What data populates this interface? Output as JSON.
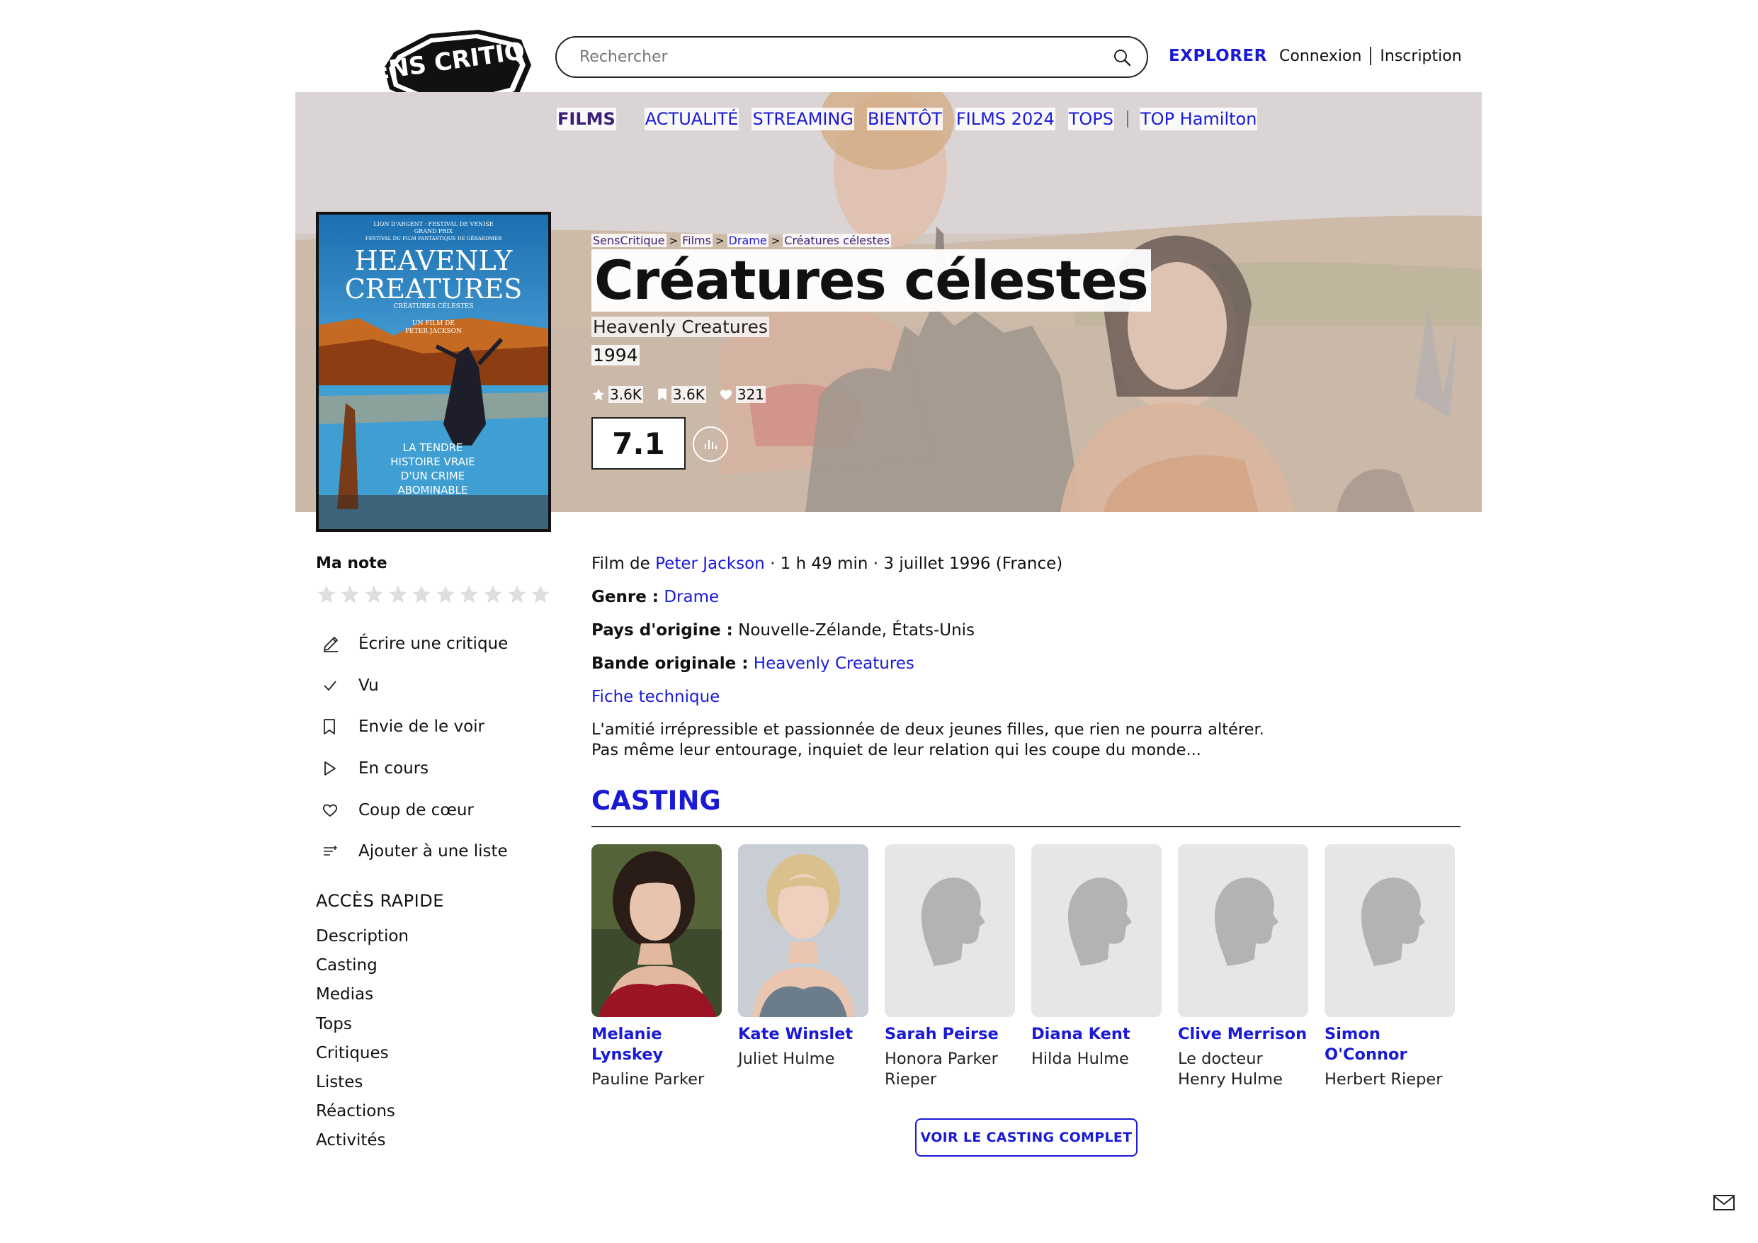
{
  "header": {
    "logo_text": "SENS CRITIQUE",
    "search_placeholder": "Rechercher",
    "explorer": "EXPLORER",
    "login": "Connexion",
    "signup": "Inscription"
  },
  "nav": {
    "active": "FILMS",
    "items": [
      "ACTUALITÉ",
      "STREAMING",
      "BIENTÔT",
      "FILMS 2024",
      "TOPS"
    ],
    "extra": "TOP Hamilton"
  },
  "breadcrumb": [
    "SensCritique",
    "Films",
    "Drame",
    "Créatures célestes"
  ],
  "movie": {
    "title": "Créatures célestes",
    "original_title": "Heavenly Creatures",
    "year": "1994",
    "stats": {
      "ratings": "3.6K",
      "wishlist": "3.6K",
      "favorites": "321"
    },
    "score": "7.1",
    "poster": {
      "top_line1": "LION D'ARGENT · FESTIVAL DE VENISE",
      "top_line2": "GRAND PRIX",
      "top_line3": "FESTIVAL DU FILM FANTASTIQUE DE GÉRARDMER",
      "title1": "HEAVENLY",
      "title2": "CREATURES",
      "subtitle": "CRÉATURES CÉLESTES",
      "by1": "UN FILM DE",
      "by2": "PETER JACKSON",
      "tag1": "LA TENDRE",
      "tag2": "HISTOIRE VRAIE",
      "tag3": "D'UN CRIME",
      "tag4": "ABOMINABLE"
    }
  },
  "sidebar": {
    "my_rating_label": "Ma note",
    "star_count": 10,
    "actions": [
      {
        "label": "Écrire une critique",
        "icon": "pencil-icon"
      },
      {
        "label": "Vu",
        "icon": "check-icon"
      },
      {
        "label": "Envie de le voir",
        "icon": "bookmark-icon"
      },
      {
        "label": "En cours",
        "icon": "play-icon"
      },
      {
        "label": "Coup de cœur",
        "icon": "heart-icon"
      },
      {
        "label": "Ajouter à une liste",
        "icon": "list-add-icon"
      }
    ],
    "quick_access_title": "ACCÈS RAPIDE",
    "quick_access": [
      "Description",
      "Casting",
      "Medias",
      "Tops",
      "Critiques",
      "Listes",
      "Réactions",
      "Activités"
    ]
  },
  "info": {
    "film_de": "Film de",
    "director": "Peter Jackson",
    "details": "· 1 h 49 min · 3 juillet 1996 (France)",
    "genre_label": "Genre :",
    "genre": "Drame",
    "country_label": "Pays d'origine :",
    "country": "Nouvelle-Zélande, États-Unis",
    "soundtrack_label": "Bande originale :",
    "soundtrack": "Heavenly Creatures",
    "tech_sheet": "Fiche technique",
    "synopsis": "L'amitié irrépressible et passionnée de deux jeunes filles, que rien ne pourra altérer. Pas même leur entourage, inquiet de leur relation qui les coupe du monde..."
  },
  "casting": {
    "title": "CASTING",
    "button": "VOIR LE CASTING COMPLET",
    "members": [
      {
        "name": "Melanie Lynskey",
        "role": "Pauline Parker",
        "photo": "photo"
      },
      {
        "name": "Kate Winslet",
        "role": "Juliet Hulme",
        "photo": "photo"
      },
      {
        "name": "Sarah Peirse",
        "role": "Honora Parker Rieper",
        "photo": "placeholder"
      },
      {
        "name": "Diana Kent",
        "role": "Hilda Hulme",
        "photo": "placeholder"
      },
      {
        "name": "Clive Merrison",
        "role": "Le docteur Henry Hulme",
        "photo": "placeholder"
      },
      {
        "name": "Simon O'Connor",
        "role": "Herbert Rieper",
        "photo": "placeholder"
      }
    ]
  },
  "colors": {
    "accent": "#1a1ad6",
    "films_nav": "#3a1f7a",
    "text": "#111111"
  }
}
